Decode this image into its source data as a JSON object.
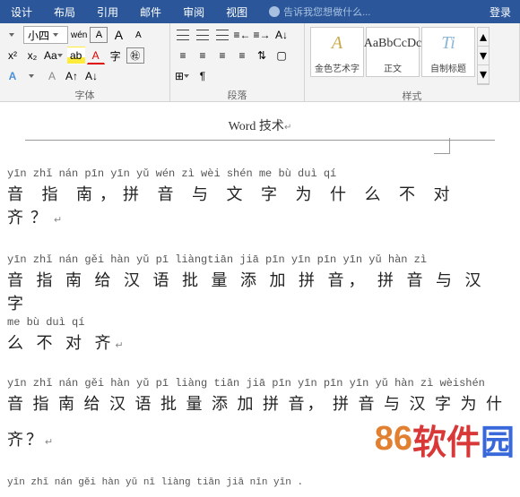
{
  "tabs": {
    "design": "设计",
    "layout": "布局",
    "references": "引用",
    "mailings": "邮件",
    "review": "审阅",
    "view": "视图",
    "tell_me": "告诉我您想做什么...",
    "login": "登录"
  },
  "font_group": {
    "label": "字体",
    "size_combo": "小四",
    "ruby_btn": "wén",
    "char_border": "A",
    "clear_fmt": "Aa",
    "grow": "A",
    "shrink": "A",
    "change_case": "A",
    "char_shading": "字",
    "enclose": "㊓"
  },
  "para_group": {
    "label": "段落"
  },
  "styles_group": {
    "label": "样式",
    "items": [
      {
        "preview": "A",
        "name": "金色艺术字",
        "cls": "style-gold"
      },
      {
        "preview": "AaBbCcDc",
        "name": "正文",
        "cls": "style-normal"
      },
      {
        "preview": "Ti",
        "name": "自制标题",
        "cls": "style-custom"
      }
    ]
  },
  "document": {
    "header": "Word 技术",
    "block1": {
      "ruby": "yīn zhǐ nán    pīn yīn yǔ wén zì wèi shén me bù duì qí",
      "hanzi": "音 指 南，拼 音 与 文 字 为 什 么 不 对 齐？"
    },
    "block2": {
      "ruby1": "yīn zhǐ nán gěi hàn yǔ  pī liàngtiān jiā pīn yīn     pīn yīn yǔ hàn zì",
      "hanzi1": "音 指 南 给 汉 语 批 量 添 加 拼 音， 拼 音 与 汉 字",
      "ruby2": "me bù duì qí",
      "hanzi2": "么 不 对 齐"
    },
    "block3": {
      "ruby1": "yīn zhǐ nán gěi hàn yǔ pī liàng tiān jiā pīn yīn    pīn yīn yǔ hàn zì wèishén",
      "hanzi1": "音 指 南 给 汉 语 批 量  添 加 拼 音， 拼 音 与 汉 字 为 什",
      "hanzi2": "齐？"
    },
    "partial": "yīn zhǐ nán gěi hàn yǔ  nī liàng tiān jiā nīn yīn ."
  },
  "watermark": {
    "d1": "8",
    "d2": "6",
    "text1": "软件",
    "text2": "园"
  }
}
